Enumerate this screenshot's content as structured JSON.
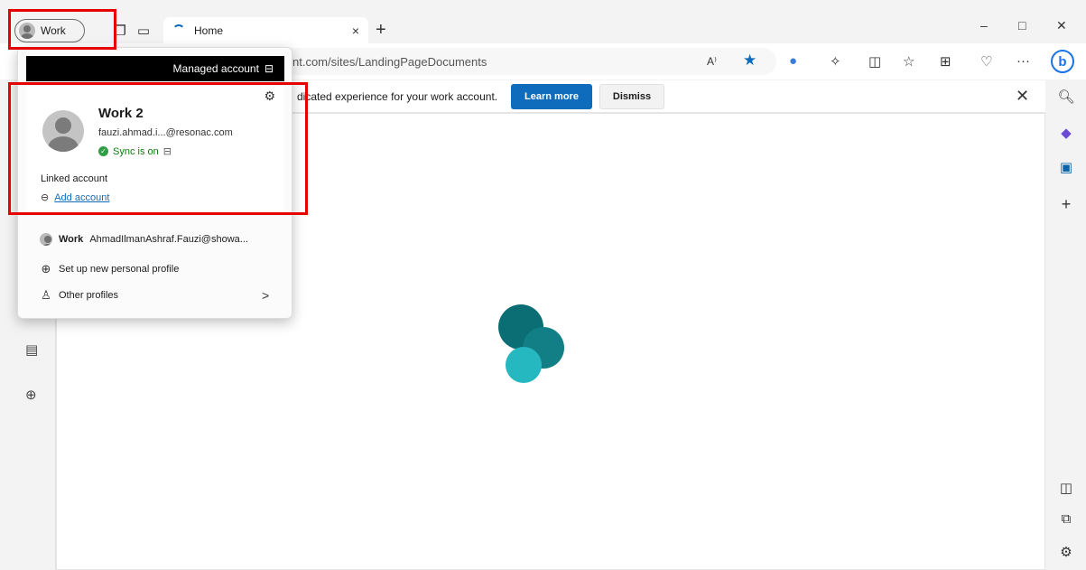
{
  "titlebar": {
    "profile_label": "Work",
    "tab_title": "Home",
    "tab_close": "×",
    "new_tab": "+",
    "minimize": "–",
    "maximize": "□",
    "close": "✕"
  },
  "addressbar": {
    "url": "nt.com/sites/LandingPageDocuments",
    "read_aloud": "A⁾",
    "more": "···"
  },
  "infobar": {
    "message": "dicated experience for your work account.",
    "learn_more": "Learn more",
    "dismiss": "Dismiss",
    "close": "✕"
  },
  "profile_flyout": {
    "managed_label": "Managed account",
    "current": {
      "name": "Work 2",
      "email": "fauzi.ahmad.i...@resonac.com",
      "sync_status": "Sync is on"
    },
    "linked_label": "Linked account",
    "add_account": "Add account",
    "other_profile": {
      "name": "Work",
      "email": "AhmadIlmanAshraf.Fauzi@showa..."
    },
    "new_personal": "Set up new personal profile",
    "other_profiles": "Other profiles"
  },
  "colors": {
    "accent": "#0f6cbd",
    "highlight": "#e60000",
    "sync_green": "#2f9e44",
    "loader_dark": "#0b6e74",
    "loader_mid": "#127f86",
    "loader_light": "#25b8c0"
  },
  "icons": {
    "gear": "⚙",
    "chevron": "›",
    "plus_circle": "⊕",
    "link": "⊖",
    "lock": "🔒"
  }
}
